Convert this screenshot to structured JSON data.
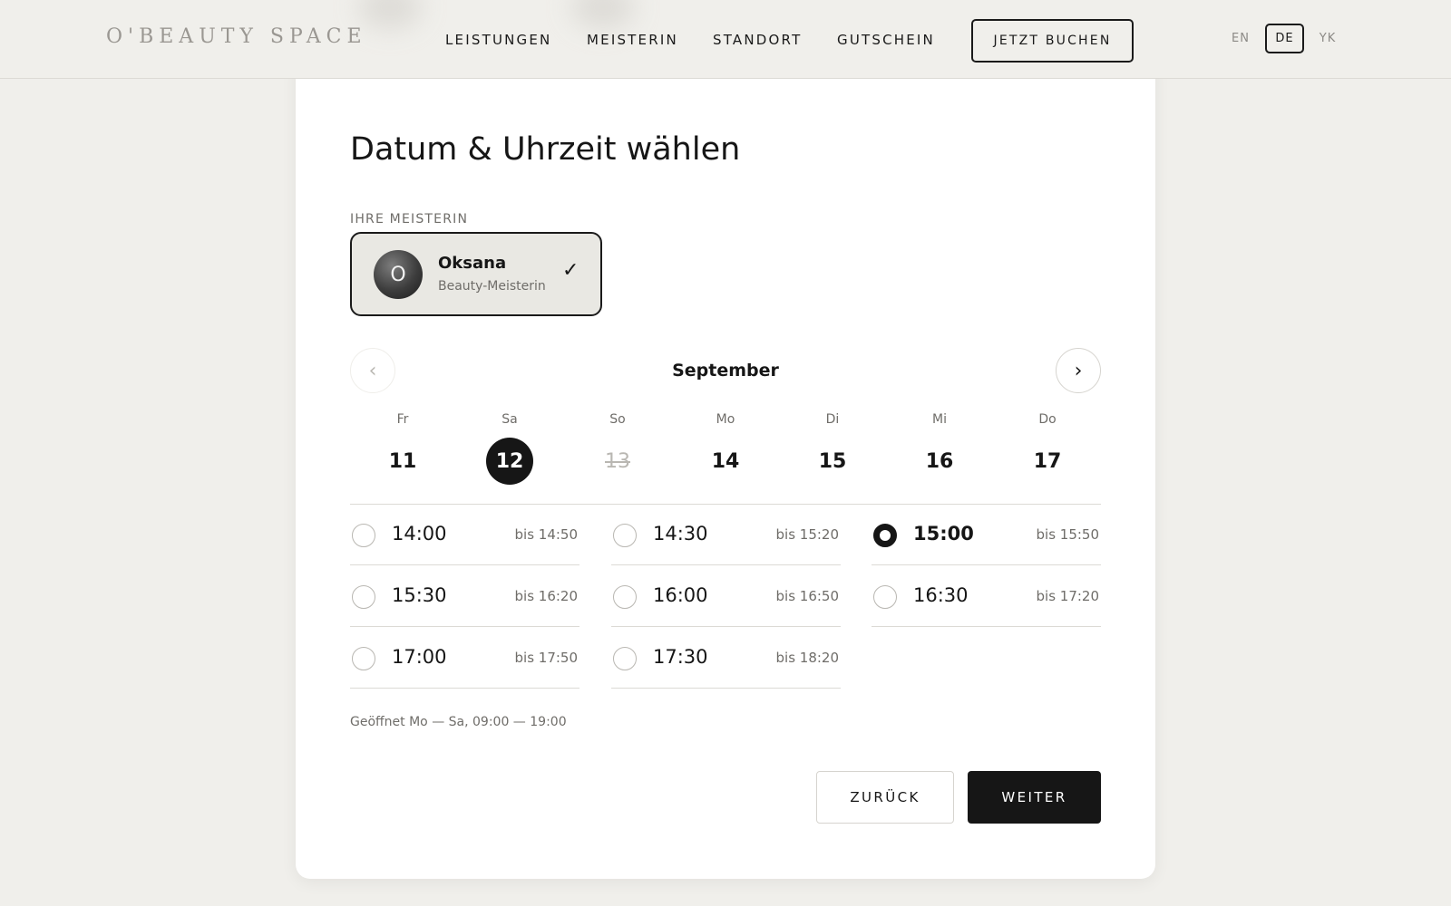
{
  "header": {
    "logo": "O'BEAUTY SPACE",
    "nav": [
      "LEISTUNGEN",
      "MEISTERIN",
      "STANDORT",
      "GUTSCHEIN"
    ],
    "book_button": "JETZT BUCHEN",
    "languages": [
      "EN",
      "DE",
      "YK"
    ],
    "active_language": "DE"
  },
  "booking": {
    "title": "Datum & Uhrzeit wählen",
    "master_section_label": "IHRE MEISTERIN",
    "master": {
      "initial": "O",
      "name": "Oksana",
      "role": "Beauty-Meisterin",
      "check": "✓"
    },
    "month": "September",
    "prev_icon": "‹",
    "next_icon": "›",
    "days": [
      {
        "dow": "Fr",
        "num": "11"
      },
      {
        "dow": "Sa",
        "num": "12"
      },
      {
        "dow": "So",
        "num": "13"
      },
      {
        "dow": "Mo",
        "num": "14"
      },
      {
        "dow": "Di",
        "num": "15"
      },
      {
        "dow": "Mi",
        "num": "16"
      },
      {
        "dow": "Do",
        "num": "17"
      }
    ],
    "selected_day": "12",
    "disabled_day": "13",
    "slots": [
      {
        "time": "14:00",
        "until": "bis 14:50"
      },
      {
        "time": "14:30",
        "until": "bis 15:20"
      },
      {
        "time": "15:00",
        "until": "bis 15:50"
      },
      {
        "time": "15:30",
        "until": "bis 16:20"
      },
      {
        "time": "16:00",
        "until": "bis 16:50"
      },
      {
        "time": "16:30",
        "until": "bis 17:20"
      },
      {
        "time": "17:00",
        "until": "bis 17:50"
      },
      {
        "time": "17:30",
        "until": "bis 18:20"
      }
    ],
    "selected_slot": "15:00",
    "opening_hours": "Geöffnet Mo — Sa, 09:00 — 19:00",
    "back_button": "ZURÜCK",
    "next_button": "WEITER"
  },
  "colors": {
    "background": "#f0efeb",
    "card": "#ffffff",
    "ink": "#161616",
    "muted": "#6f6d69",
    "selected_master_bg": "#e9e8e3"
  },
  "icons": {
    "prev": "chevron-left-icon",
    "next": "chevron-right-icon",
    "check": "check-icon",
    "radio": "radio-icon"
  }
}
